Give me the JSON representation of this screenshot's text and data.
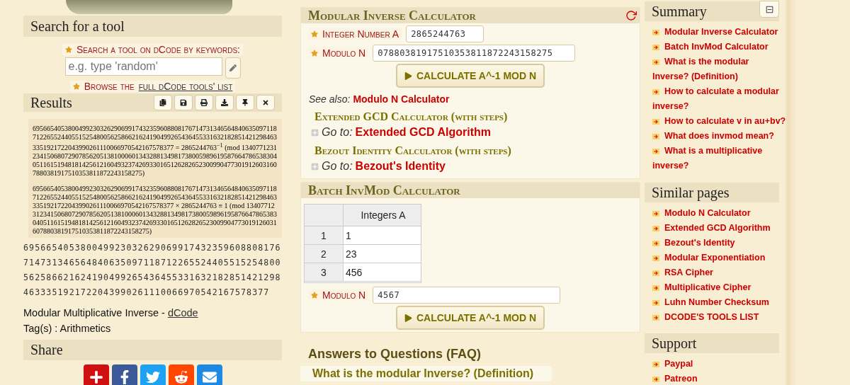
{
  "search": {
    "title": "Search for a tool",
    "label": "Search a tool on dCode by keywords:",
    "placeholder": "e.g. type 'random'",
    "browse_prefix": "Browse the ",
    "browse_link": "full dCode tools' list"
  },
  "results": {
    "title": "Results",
    "tools": [
      {
        "kind": "copy"
      },
      {
        "kind": "save"
      },
      {
        "kind": "print"
      },
      {
        "kind": "download"
      },
      {
        "kind": "pin"
      },
      {
        "kind": "close"
      }
    ],
    "math": [
      {
        "number": "6956654053800499230326290699174323596088081767147313465648406350971187122655244055152548005625866216241904992654364553316321828514212984633351921722043990261110066970542167578377",
        "relation": "= 2865244763$^{−1}$",
        "mod_open": "(mod",
        "modulus": "13407712312341506807290785620513810006013432881349817380059896195876647865383040511615194818142561216049323742693301651262826523009904773019126031607880381917510353811872243158275)"
      },
      {
        "number": "6956654053800499230326290699174323596088081767147313465648406350971187122655244055152548005625866216241904992654364553316321828514212984633351921722043990261110066970542167578377",
        "relation": "× 2865244763 ≡ 1",
        "mod_open": "(mod",
        "modulus": "13407712312341506807290785620513810006013432881349817380059896195876647865383040511615194818142561216049323742693301651262826523009904773019126031607880381917510353811872243158275)"
      }
    ],
    "plain": "6956654053800499230326290699174323596088081767147313465648406350971187122655244055152548005625866216241904992654364553316321828514212984633351921722043990261110066970542167578377",
    "credit": "Modular Multiplicative Inverse - ",
    "credit_link": "dCode",
    "tags": "Tag(s) : Arithmetics"
  },
  "share": {
    "title": "Share",
    "buttons": [
      {
        "kind": "add"
      },
      {
        "kind": "facebook"
      },
      {
        "kind": "twitter"
      },
      {
        "kind": "reddit"
      },
      {
        "kind": "mail"
      }
    ]
  },
  "calculator": {
    "title": "Modular Inverse Calculator",
    "fields": [
      {
        "label": "Integer Number A",
        "value": "2865244763"
      },
      {
        "label": "Modulo N",
        "value": "07880381917510353811872243158275"
      }
    ],
    "button": "CALCULATE A^-1 MOD N",
    "see_also_label": "See also:",
    "see_also_link": "Modulo N Calculator",
    "related": [
      {
        "title": "Extended GCD Calculator (with steps)",
        "goto": "Go to:",
        "link": "Extended GCD Algorithm"
      },
      {
        "title": "Bezout Identity Calculator (with steps)",
        "goto": "Go to:",
        "link": "Bezout's Identity"
      }
    ]
  },
  "batch": {
    "title": "Batch InvMod Calculator",
    "table": {
      "columns": [
        "Integers A"
      ],
      "rows": [
        {
          "index": "1",
          "value": "1"
        },
        {
          "index": "2",
          "value": "23"
        },
        {
          "index": "3",
          "value": "456"
        }
      ]
    },
    "field": {
      "label": "Modulo N",
      "value": "4567"
    },
    "button": "CALCULATE A^-1 MOD N"
  },
  "faq": {
    "title": "Answers to Questions (FAQ)",
    "question": "What is the modular Inverse? (Definition)"
  },
  "sidebar": [
    {
      "title": "Summary",
      "collapsible": true,
      "items": [
        "Modular Inverse Calculator",
        "Batch InvMod Calculator",
        "What is the modular Inverse? (Definition)",
        "How to calculate a modular inverse?",
        "How to calculate v in au+bv?",
        "What does invmod mean?",
        "What is a multiplicative inverse?"
      ]
    },
    {
      "title": "Similar pages",
      "collapsible": false,
      "items": [
        "Modulo N Calculator",
        "Extended GCD Algorithm",
        "Bezout's Identity",
        "Modular Exponentiation",
        "RSA Cipher",
        "Multiplicative Cipher",
        "Luhn Number Checksum",
        "DCODE'S TOOLS LIST"
      ]
    },
    {
      "title": "Support",
      "collapsible": false,
      "items": [
        "Paypal",
        "Patreon"
      ]
    }
  ]
}
